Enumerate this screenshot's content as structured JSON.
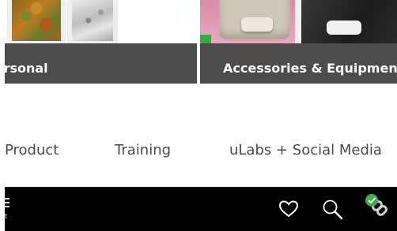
{
  "categories": [
    {
      "label": "Personal"
    },
    {
      "label": "Accessories & Equipment"
    }
  ],
  "nav_links": [
    {
      "label": "Product"
    },
    {
      "label": "Training"
    },
    {
      "label": "uLabs + Social  Media"
    }
  ],
  "bottom_bar": {
    "menu_label": "t",
    "icons": [
      "menu-icon",
      "heart-icon",
      "search-icon",
      "share-link-icon",
      "check-badge-icon"
    ]
  },
  "colors": {
    "banner": "#4c4c4c",
    "bottom_bar": "#000000",
    "nav_text": "#4a4a4a",
    "badge_green": "#3fae49"
  }
}
